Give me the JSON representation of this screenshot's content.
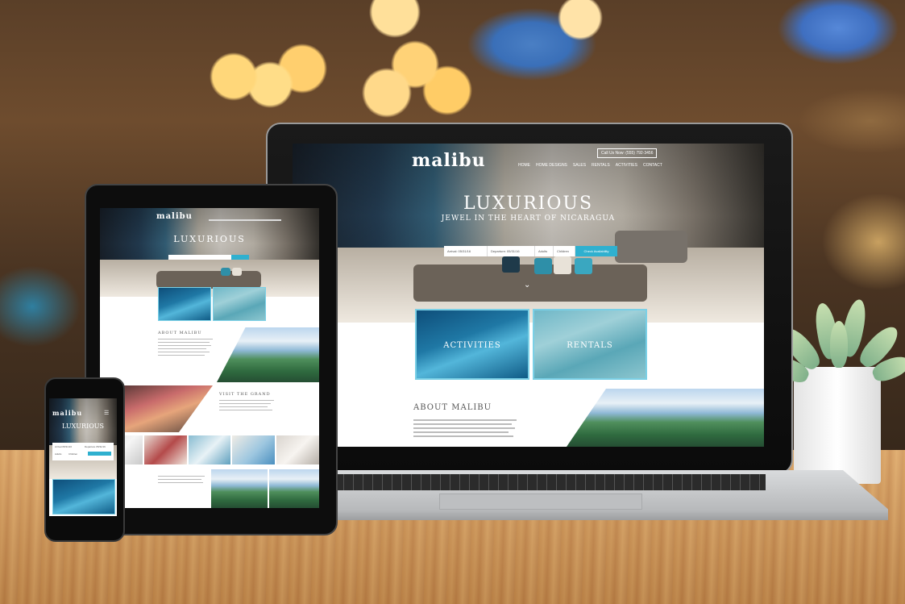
{
  "brand": {
    "name": "malibu"
  },
  "desktop": {
    "call_label": "Call Us Now: (555) 792-3456",
    "nav": [
      "HOME",
      "HOME DESIGNS",
      "SALES",
      "RENTALS",
      "ACTIVITIES",
      "CONTACT"
    ],
    "hero_title": "LUXURIOUS",
    "hero_subtitle": "JEWEL IN THE HEART OF NICARAGUA",
    "form": {
      "arrival": "Arrival: 05/31/16",
      "departure": "Departure: 05/31/16",
      "adults": "Adults",
      "children": "Children",
      "button": "Check Availability"
    },
    "tiles": [
      "ACTIVITIES",
      "RENTALS"
    ],
    "about_heading": "ABOUT MALIBU",
    "about_text": "Once upon a sleepy fishing town, San Juan Del Sur has emerged as the most popular tourist destination in Nicaragua as well as a hub of tourism for all of Central America. In recent years, the municipality of San Juan Del Sur has experienced a surge in"
  },
  "tablet": {
    "hero_title": "LUXURIOUS",
    "about_heading": "ABOUT MALIBU",
    "section2_heading": "VISIT THE GRAND"
  },
  "phone": {
    "hero_title": "LUXURIOUS",
    "form_arrival": "Arrival 05/31/16",
    "form_departure": "Departure 05/31/16",
    "form_adults": "Adults",
    "form_children": "Children"
  },
  "colors": {
    "accent": "#2fb0cf",
    "tile_border": "#7bd0e6"
  }
}
